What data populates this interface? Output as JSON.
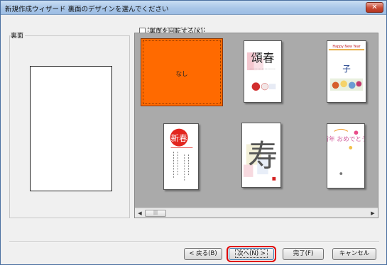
{
  "window": {
    "title": "新規作成ウィザード 裏面のデザインを選んでください",
    "close_label": "✕"
  },
  "options": {
    "rotate_label": "裏面を回転する(K)"
  },
  "back_panel": {
    "label": "裏面"
  },
  "gallery": {
    "none_label": "なし",
    "cards": [
      {
        "name": "card-shunsho",
        "text": "頌春"
      },
      {
        "name": "card-happy-new-year",
        "text": "Happy New Year"
      },
      {
        "name": "card-shinshun",
        "text": "新春"
      },
      {
        "name": "card-kotobuki",
        "text": "寿"
      },
      {
        "name": "card-shinnen-omedetou",
        "text": "新年 おめでとう"
      }
    ]
  },
  "buttons": {
    "back": "< 戻る(B)",
    "next": "次へ(N) >",
    "finish": "完了(F)",
    "cancel": "キャンセル"
  },
  "colors": {
    "selected_tile": "#ff6a00",
    "highlight": "#e00000"
  }
}
